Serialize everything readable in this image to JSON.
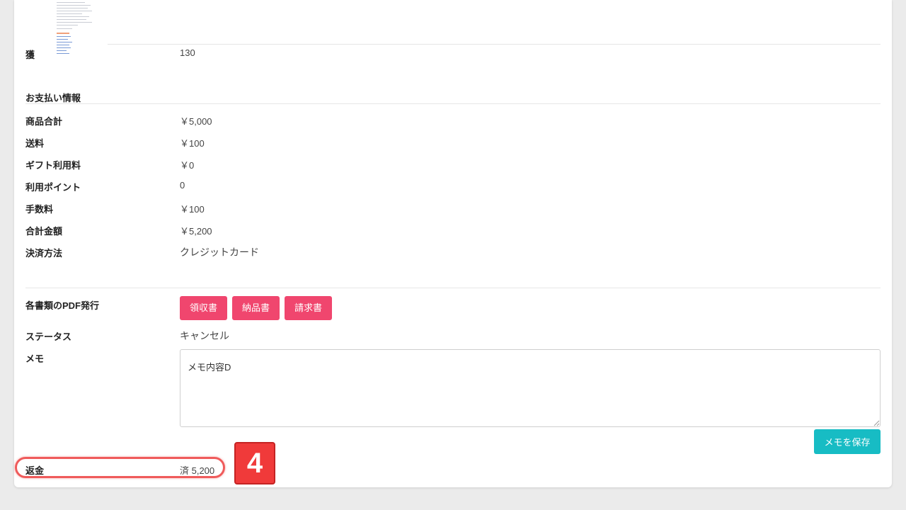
{
  "order": {
    "partial_row": {
      "label": "獲",
      "value": "130"
    }
  },
  "payment": {
    "section_title": "お支払い情報",
    "rows": [
      {
        "label": "商品合計",
        "value": "￥5,000"
      },
      {
        "label": "送料",
        "value": "￥100"
      },
      {
        "label": "ギフト利用料",
        "value": "￥0"
      },
      {
        "label": "利用ポイント",
        "value": "0"
      },
      {
        "label": "手数料",
        "value": "￥100"
      },
      {
        "label": "合計金額",
        "value": "￥5,200"
      },
      {
        "label": "決済方法",
        "value": "クレジットカード"
      }
    ]
  },
  "documents": {
    "label": "各書類のPDF発行",
    "buttons": [
      "領収書",
      "納品書",
      "請求書"
    ]
  },
  "status": {
    "label": "ステータス",
    "value": "キャンセル"
  },
  "memo": {
    "label": "メモ",
    "text": "メモ内容D",
    "save_label": "メモを保存"
  },
  "refund": {
    "label": "返金",
    "value": "済 5,200"
  },
  "annotation": {
    "step_number": "4"
  },
  "colors": {
    "pdf_button": "#f0466e",
    "save_button": "#17bcc4",
    "annotation_red": "#f03a3a"
  }
}
